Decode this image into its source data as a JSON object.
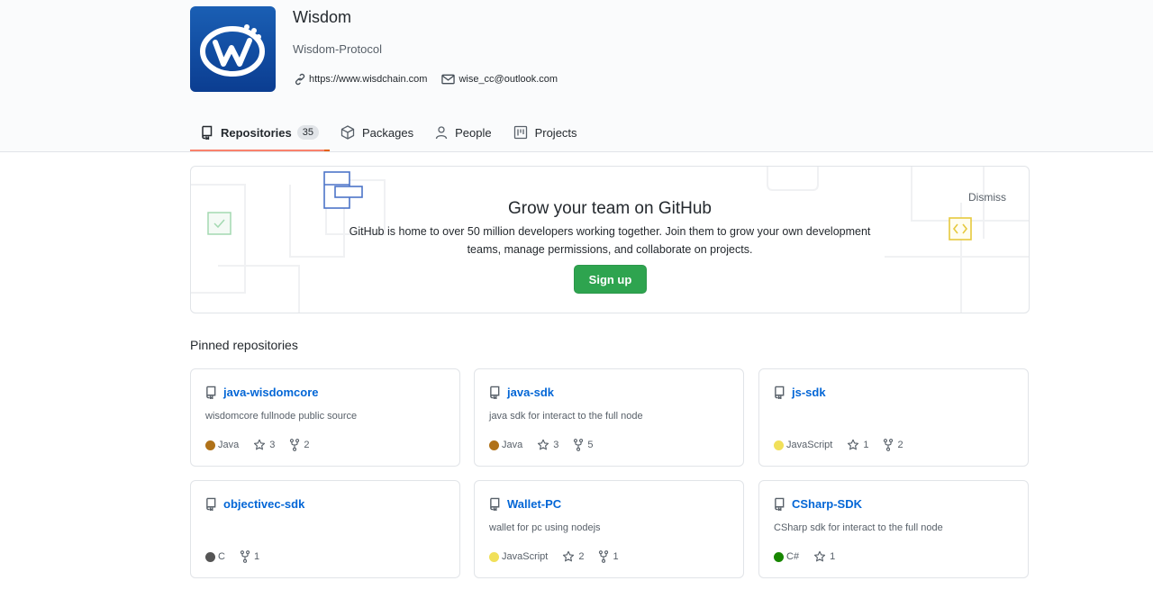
{
  "org": {
    "name": "Wisdom",
    "description": "Wisdom-Protocol",
    "website": "https://www.wisdchain.com",
    "email": "wise_cc@outlook.com"
  },
  "tabs": [
    {
      "label": "Repositories",
      "count": "35",
      "selected": true,
      "icon": "repo-icon"
    },
    {
      "label": "Packages",
      "icon": "package-icon"
    },
    {
      "label": "People",
      "icon": "person-icon"
    },
    {
      "label": "Projects",
      "icon": "project-icon"
    }
  ],
  "banner": {
    "title": "Grow your team on GitHub",
    "text": "GitHub is home to over 50 million developers working together. Join them to grow your own development teams, manage permissions, and collaborate on projects.",
    "signup_label": "Sign up",
    "dismiss_label": "Dismiss"
  },
  "pinned": {
    "title": "Pinned repositories",
    "repos": [
      {
        "name": "java-wisdomcore",
        "description": "wisdomcore fullnode public source",
        "language": "Java",
        "lang_color": "#b07219",
        "stars": "3",
        "forks": "2"
      },
      {
        "name": "java-sdk",
        "description": "java sdk for interact to the full node",
        "language": "Java",
        "lang_color": "#b07219",
        "stars": "3",
        "forks": "5"
      },
      {
        "name": "js-sdk",
        "description": "",
        "language": "JavaScript",
        "lang_color": "#f1e05a",
        "stars": "1",
        "forks": "2"
      },
      {
        "name": "objectivec-sdk",
        "description": "",
        "language": "C",
        "lang_color": "#555555",
        "stars": null,
        "forks": "1"
      },
      {
        "name": "Wallet-PC",
        "description": "wallet for pc using nodejs",
        "language": "JavaScript",
        "lang_color": "#f1e05a",
        "stars": "2",
        "forks": "1"
      },
      {
        "name": "CSharp-SDK",
        "description": "CSharp sdk for interact to the full node",
        "language": "C#",
        "lang_color": "#178600",
        "stars": "1",
        "forks": null
      }
    ]
  }
}
